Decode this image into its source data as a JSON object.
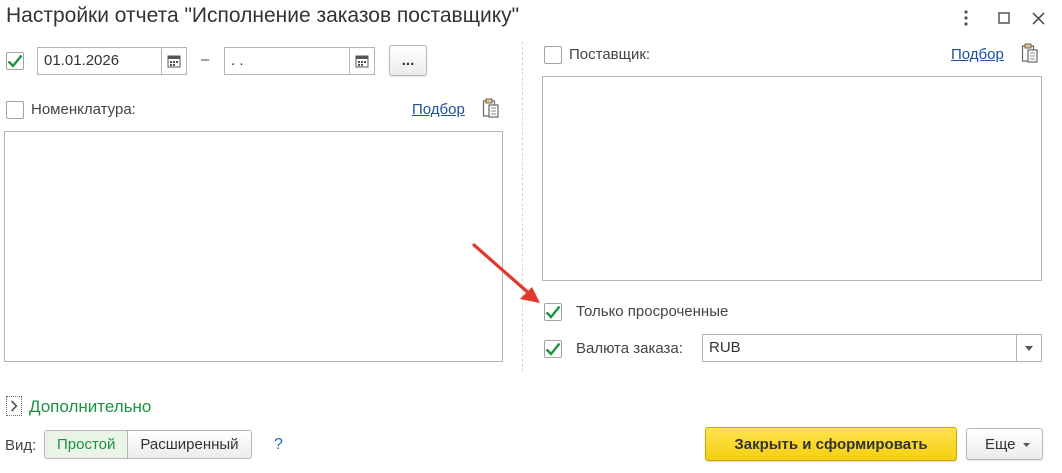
{
  "window": {
    "title": "Настройки отчета \"Исполнение заказов поставщику\"",
    "menu_icon": "kebab-menu-icon",
    "maximize_icon": "maximize-icon",
    "close_icon": "close-icon"
  },
  "period": {
    "enabled": true,
    "date_from": "01.01.2026",
    "dash": "–",
    "date_to": " .  .",
    "select_button": "..."
  },
  "nomenclature": {
    "checked": false,
    "label": "Номенклатура:",
    "pick_link": "Подбор"
  },
  "supplier": {
    "checked": false,
    "label": "Поставщик:",
    "pick_link": "Подбор"
  },
  "overdue_only": {
    "checked": true,
    "label": "Только просроченные"
  },
  "currency": {
    "checked": true,
    "label": "Валюта заказа:",
    "value": "RUB"
  },
  "additional": {
    "label": "Дополнительно"
  },
  "view": {
    "label": "Вид:",
    "options": [
      "Простой",
      "Расширенный"
    ],
    "selected": "Простой",
    "help": "?"
  },
  "footer": {
    "primary_button": "Закрыть и сформировать",
    "more_button": "Еще"
  },
  "colors": {
    "accent_green": "#1a9342",
    "link_blue": "#1c4f9c",
    "primary_yellow": "#f5cf0f",
    "arrow_red": "#e0382b"
  }
}
